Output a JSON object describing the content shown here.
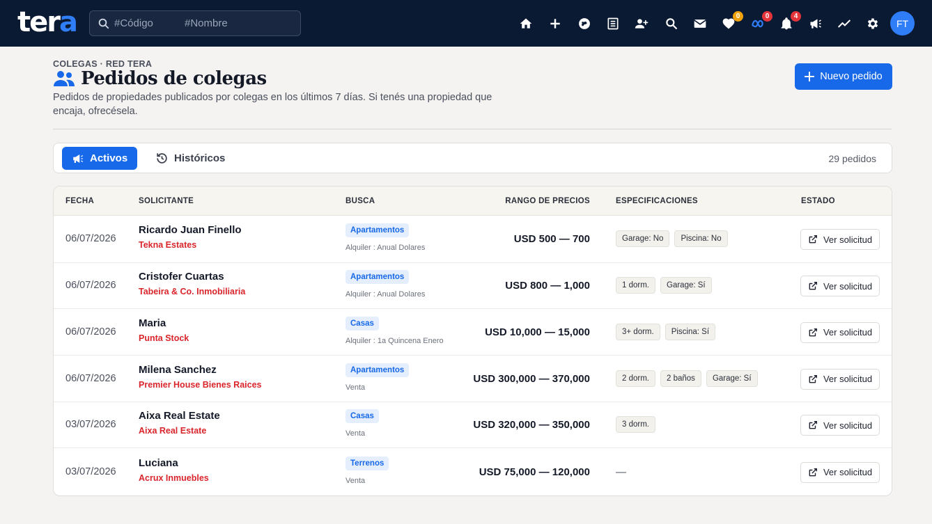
{
  "brand": {
    "logo_main": "ter",
    "logo_accent": "a"
  },
  "search": {
    "codigo_placeholder": "#Código",
    "nombre_placeholder": "#Nombre"
  },
  "nav": {
    "favorites_badge": "0",
    "meta_badge": "0",
    "notifications_badge": "4",
    "avatar_initials": "FT"
  },
  "page": {
    "breadcrumb": "COLEGAS · RED TERA",
    "title": "Pedidos de colegas",
    "description": "Pedidos de propiedades publicados por colegas en los últimos 7 días. Si tenés una propiedad que encaja, ofrecésela.",
    "new_button_label": "Nuevo pedido"
  },
  "tabs": {
    "active_label": "Activos",
    "history_label": "Históricos",
    "count_label": "29 pedidos"
  },
  "table": {
    "headers": {
      "fecha": "FECHA",
      "solicitante": "SOLICITANTE",
      "busca": "BUSCA",
      "rango": "RANGO DE PRECIOS",
      "especificaciones": "ESPECIFICACIONES",
      "estado": "ESTADO"
    },
    "action_label": "Ver solicitud",
    "rows": [
      {
        "date": "06/07/2026",
        "name": "Ricardo Juan Finello",
        "agency": "Tekna Estates",
        "type": "Apartamentos",
        "operation": "Alquiler : Anual Dolares",
        "price": "USD 500 — 700",
        "specs": [
          "Garage: No",
          "Piscina: No"
        ]
      },
      {
        "date": "06/07/2026",
        "name": "Cristofer Cuartas",
        "agency": "Tabeira & Co. Inmobiliaria",
        "type": "Apartamentos",
        "operation": "Alquiler : Anual Dolares",
        "price": "USD 800 — 1,000",
        "specs": [
          "1 dorm.",
          "Garage: Sí"
        ]
      },
      {
        "date": "06/07/2026",
        "name": "Maria",
        "agency": "Punta Stock",
        "type": "Casas",
        "operation": "Alquiler : 1a Quincena Enero",
        "price": "USD 10,000 — 15,000",
        "specs": [
          "3+ dorm.",
          "Piscina: Sí"
        ]
      },
      {
        "date": "06/07/2026",
        "name": "Milena Sanchez",
        "agency": "Premier House Bienes Raices",
        "type": "Apartamentos",
        "operation": "Venta",
        "price": "USD 300,000 — 370,000",
        "specs": [
          "2 dorm.",
          "2 baños",
          "Garage: Sí"
        ]
      },
      {
        "date": "03/07/2026",
        "name": "Aixa Real Estate",
        "agency": "Aixa Real Estate",
        "type": "Casas",
        "operation": "Venta",
        "price": "USD 320,000 — 350,000",
        "specs": [
          "3 dorm."
        ]
      },
      {
        "date": "03/07/2026",
        "name": "Luciana",
        "agency": "Acrux Inmuebles",
        "type": "Terrenos",
        "operation": "Venta",
        "price": "USD 75,000 — 120,000",
        "specs": [],
        "specs_empty": "—"
      }
    ]
  },
  "colors": {
    "navbar": "#0b1a33",
    "accent": "#1769e9",
    "agency_red": "#d9252b",
    "fav_badge": "#f0a20a",
    "meta_badge": "#e5353a",
    "notif_badge": "#e5353a"
  }
}
